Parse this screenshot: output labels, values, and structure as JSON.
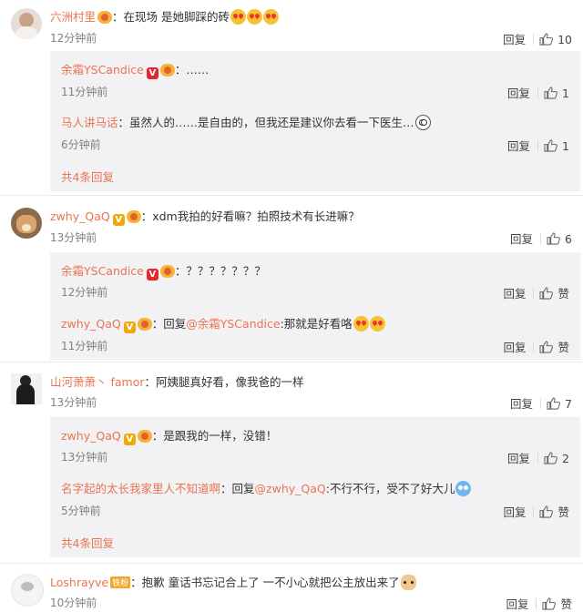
{
  "comments": [
    {
      "user": "六洲村里",
      "text": "在现场 是她脚踩的砖",
      "time": "12分钟前",
      "reply": "回复",
      "likes": "10",
      "subreplies": [
        {
          "user": "余霜YSCandice",
          "text": "……",
          "time": "11分钟前",
          "reply": "回复",
          "likes": "1"
        },
        {
          "user": "马人讲马话",
          "text": "虽然人的……是自由的，但我还是建议你去看一下医生…",
          "time": "6分钟前",
          "reply": "回复",
          "likes": "1"
        }
      ],
      "more": "共4条回复"
    },
    {
      "user": "zwhy_QaQ",
      "text": "xdm我拍的好看嘛？拍照技术有长进嘛？",
      "time": "13分钟前",
      "reply": "回复",
      "likes": "6",
      "subreplies": [
        {
          "user": "余霜YSCandice",
          "text": "？？？？？？？",
          "time": "12分钟前",
          "reply": "回复",
          "likes": "赞"
        },
        {
          "user": "zwhy_QaQ",
          "prefix": "回复",
          "mention": "@余霜YSCandice",
          "text": ":那就是好看咯",
          "time": "11分钟前",
          "reply": "回复",
          "likes": "赞"
        }
      ]
    },
    {
      "user": "山河萧萧丶 famor",
      "text": "阿姨腿真好看，像我爸的一样",
      "time": "13分钟前",
      "reply": "回复",
      "likes": "7",
      "subreplies": [
        {
          "user": "zwhy_QaQ",
          "text": "是跟我的一样，没错！",
          "time": "13分钟前",
          "reply": "回复",
          "likes": "2"
        },
        {
          "user": "名字起的太长我家里人不知道啊",
          "prefix": "回复",
          "mention": "@zwhy_QaQ",
          "text": ":不行不行，受不了好大儿",
          "time": "5分钟前",
          "reply": "回复",
          "likes": "赞"
        }
      ],
      "more": "共4条回复"
    },
    {
      "user": "Loshrayve",
      "badge": "铁粉",
      "text": "抱歉 童话书忘记合上了 一不小心就把公主放出来了",
      "time": "10分钟前",
      "reply": "回复",
      "likes": "赞"
    }
  ],
  "colors": {
    "name": "#eb7350",
    "reply_bg": "#f2f2f5",
    "time": "#808080"
  }
}
